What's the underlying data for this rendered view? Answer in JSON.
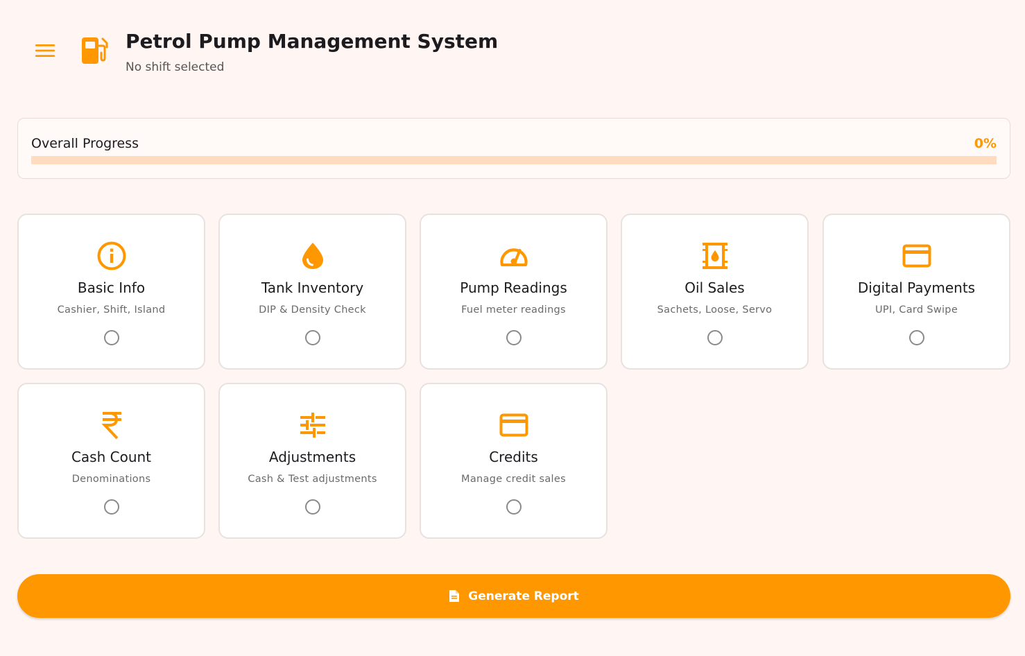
{
  "header": {
    "menu_icon": "menu-icon",
    "app_icon": "fuel-pump-icon",
    "title": "Petrol Pump Management System",
    "subtitle": "No shift selected"
  },
  "progress": {
    "label": "Overall Progress",
    "value_text": "0%",
    "value": 0
  },
  "cards": [
    {
      "icon": "info-icon",
      "title": "Basic Info",
      "subtitle": "Cashier, Shift, Island",
      "completed": false
    },
    {
      "icon": "water-drop-icon",
      "title": "Tank Inventory",
      "subtitle": "DIP & Density Check",
      "completed": false
    },
    {
      "icon": "speedometer-icon",
      "title": "Pump Readings",
      "subtitle": "Fuel meter readings",
      "completed": false
    },
    {
      "icon": "oil-barrel-icon",
      "title": "Oil Sales",
      "subtitle": "Sachets, Loose, Servo",
      "completed": false
    },
    {
      "icon": "credit-card-icon",
      "title": "Digital Payments",
      "subtitle": "UPI, Card Swipe",
      "completed": false
    },
    {
      "icon": "rupee-icon",
      "title": "Cash Count",
      "subtitle": "Denominations",
      "completed": false
    },
    {
      "icon": "tune-icon",
      "title": "Adjustments",
      "subtitle": "Cash & Test adjustments",
      "completed": false
    },
    {
      "icon": "credit-card-icon",
      "title": "Credits",
      "subtitle": "Manage credit sales",
      "completed": false
    }
  ],
  "generate_button": {
    "icon": "document-icon",
    "label": "Generate Report"
  },
  "colors": {
    "accent": "#ff9800",
    "background": "#fff6f3",
    "progress_track": "#ffdcbf"
  }
}
